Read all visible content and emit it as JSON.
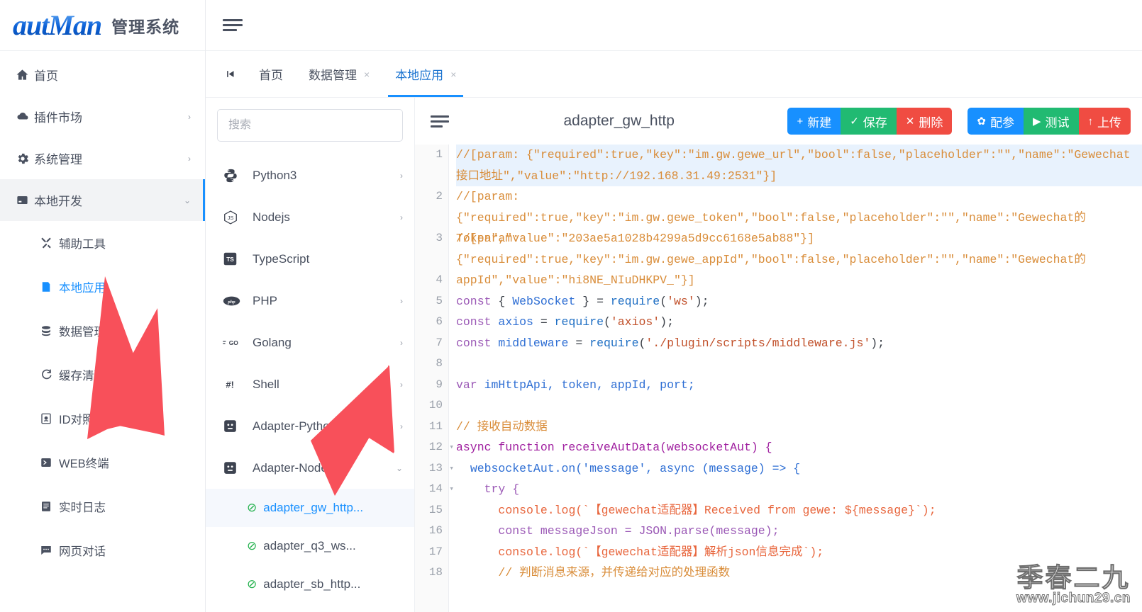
{
  "app": {
    "logo_main": "autMan",
    "logo_sub": "管理系统"
  },
  "sidebar": {
    "items": [
      {
        "label": "首页",
        "icon": "home-icon",
        "arrow": ""
      },
      {
        "label": "插件市场",
        "icon": "cloud-icon",
        "arrow": "›"
      },
      {
        "label": "系统管理",
        "icon": "gear-icon",
        "arrow": "›"
      },
      {
        "label": "本地开发",
        "icon": "server-icon",
        "arrow": "⌄"
      }
    ],
    "sub_items": [
      {
        "label": "辅助工具",
        "icon": "tools-icon"
      },
      {
        "label": "本地应用",
        "icon": "app-icon"
      },
      {
        "label": "数据管理",
        "icon": "database-icon"
      },
      {
        "label": "缓存清理",
        "icon": "refresh-icon"
      },
      {
        "label": "ID对照表",
        "icon": "id-card-icon"
      },
      {
        "label": "WEB终端",
        "icon": "terminal-icon"
      },
      {
        "label": "实时日志",
        "icon": "log-icon"
      },
      {
        "label": "网页对话",
        "icon": "chat-icon"
      }
    ]
  },
  "tabs": {
    "prev_icon": "skip-backward-icon",
    "items": [
      {
        "label": "首页",
        "closable": false,
        "close": ""
      },
      {
        "label": "数据管理",
        "closable": true,
        "close": "×"
      },
      {
        "label": "本地应用",
        "closable": true,
        "close": "×"
      }
    ],
    "active_index": 2
  },
  "tree": {
    "search_placeholder": "搜索",
    "search_value": "",
    "rows": [
      {
        "label": "Python3",
        "icon": "python-icon",
        "arrow": "›"
      },
      {
        "label": "Nodejs",
        "icon": "nodejs-icon",
        "arrow": "›"
      },
      {
        "label": "TypeScript",
        "icon": "typescript-icon",
        "arrow": ""
      },
      {
        "label": "PHP",
        "icon": "php-icon",
        "arrow": "›"
      },
      {
        "label": "Golang",
        "icon": "golang-icon",
        "arrow": "›"
      },
      {
        "label": "Shell",
        "icon": "shell-icon",
        "arrow": "›"
      },
      {
        "label": "Adapter-Python3",
        "icon": "adapter-icon",
        "arrow": "›"
      },
      {
        "label": "Adapter-Nodejs",
        "icon": "adapter-icon",
        "arrow": "⌄"
      }
    ],
    "leaves": [
      {
        "label": "adapter_gw_http...",
        "status": "⊘",
        "selected": true
      },
      {
        "label": "adapter_q3_ws...",
        "status": "⊘",
        "selected": false
      },
      {
        "label": "adapter_sb_http...",
        "status": "⊘",
        "selected": false
      }
    ]
  },
  "editor": {
    "file_title": "adapter_gw_http",
    "buttons_group1": [
      {
        "label": "新建",
        "glyph": "+",
        "color": "#1890ff",
        "name": "new-button"
      },
      {
        "label": "保存",
        "glyph": "✓",
        "color": "#21ba72",
        "name": "save-button"
      },
      {
        "label": "删除",
        "glyph": "✕",
        "color": "#f04c42",
        "name": "delete-button"
      }
    ],
    "buttons_group2": [
      {
        "label": "配参",
        "glyph": "✿",
        "color": "#1890ff",
        "name": "config-params-button"
      },
      {
        "label": "测试",
        "glyph": "▶",
        "color": "#21ba72",
        "name": "test-button"
      },
      {
        "label": "上传",
        "glyph": "↑",
        "color": "#f04c42",
        "name": "upload-button"
      }
    ],
    "code_lines": [
      {
        "n": 1,
        "fold": false,
        "wrapped": true,
        "highlight": true
      },
      {
        "n": 2,
        "fold": false,
        "wrapped": true,
        "highlight": false
      },
      {
        "n": 3,
        "fold": false,
        "wrapped": true,
        "highlight": false
      },
      {
        "n": 4,
        "fold": false,
        "wrapped": false,
        "highlight": false
      },
      {
        "n": 5,
        "fold": false,
        "wrapped": false,
        "highlight": false
      },
      {
        "n": 6,
        "fold": false,
        "wrapped": false,
        "highlight": false
      },
      {
        "n": 7,
        "fold": false,
        "wrapped": false,
        "highlight": false
      },
      {
        "n": 8,
        "fold": false,
        "wrapped": false,
        "highlight": false
      },
      {
        "n": 9,
        "fold": false,
        "wrapped": false,
        "highlight": false
      },
      {
        "n": 10,
        "fold": false,
        "wrapped": false,
        "highlight": false
      },
      {
        "n": 11,
        "fold": false,
        "wrapped": false,
        "highlight": false
      },
      {
        "n": 12,
        "fold": true,
        "wrapped": false,
        "highlight": false
      },
      {
        "n": 13,
        "fold": true,
        "wrapped": false,
        "highlight": false
      },
      {
        "n": 14,
        "fold": true,
        "wrapped": false,
        "highlight": false
      },
      {
        "n": 15,
        "fold": false,
        "wrapped": false,
        "highlight": false
      },
      {
        "n": 16,
        "fold": false,
        "wrapped": false,
        "highlight": false
      },
      {
        "n": 17,
        "fold": false,
        "wrapped": false,
        "highlight": false
      },
      {
        "n": 18,
        "fold": false,
        "wrapped": false,
        "highlight": false
      }
    ],
    "code_text": {
      "l1": "//[param: {\"required\":true,\"key\":\"im.gw.gewe_url\",\"bool\":false,\"placeholder\":\"\",\"name\":\"Gewechat接口地址\",\"value\":\"http://192.168.31.49:2531\"}]",
      "l2": "//[param: {\"required\":true,\"key\":\"im.gw.gewe_token\",\"bool\":false,\"placeholder\":\"\",\"name\":\"Gewechat的Token\",\"value\":\"203ae5a1028b4299a5d9cc6168e5ab88\"}]",
      "l3": "//[param: {\"required\":true,\"key\":\"im.gw.gewe_appId\",\"bool\":false,\"placeholder\":\"\",\"name\":\"Gewechat的appId\",\"value\":\"hi8NE_NIuDHKPV_\"}]",
      "l4": "",
      "l5_kw": "const",
      "l5_cls": "WebSocket",
      "l5_fn": "require",
      "l5_str": "'ws'",
      "l6_kw": "const",
      "l6_var": "axios",
      "l6_fn": "require",
      "l6_str": "'axios'",
      "l7_kw": "const",
      "l7_var": "middleware",
      "l7_fn": "require",
      "l7_str": "'./plugin/scripts/middleware.js'",
      "l9_kw": "var",
      "l9_vars": "imHttpApi, token, appId, port;",
      "l11": "// 接收自动数据",
      "l12": "async function receiveAutData(websocketAut) {",
      "l13": "websocketAut.on('message', async (message) => {",
      "l14": "try {",
      "l15": "console.log(`【gewechat适配器】Received from gewe: ${message}`);",
      "l16": "const messageJson = JSON.parse(message);",
      "l17": "console.log(`【gewechat适配器】解析json信息完成`);",
      "l18": "// 判断消息来源，并传递给对应的处理函数"
    }
  },
  "watermark": {
    "cn": "季春二九",
    "url": "www.jichun29.cn"
  },
  "colors": {
    "accent": "#1890ff",
    "green": "#21ba72",
    "red": "#f04c42",
    "arrow_red": "#f8505a"
  }
}
